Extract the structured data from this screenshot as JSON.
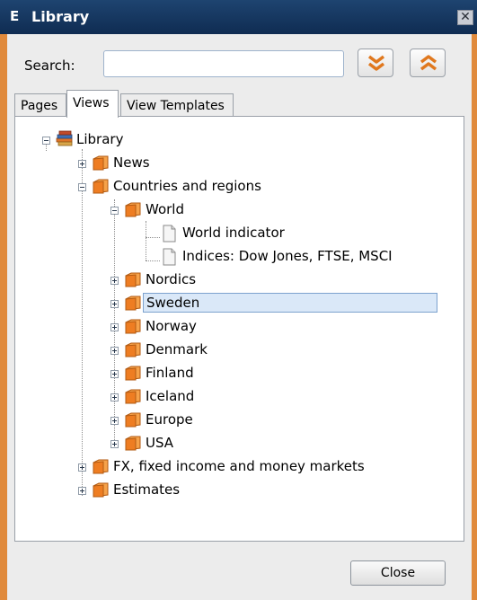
{
  "window": {
    "app_icon_letter": "E",
    "title": "Library"
  },
  "search": {
    "label": "Search:",
    "value": "",
    "placeholder": ""
  },
  "tabs": [
    {
      "label": "Pages",
      "active": false
    },
    {
      "label": "Views",
      "active": true
    },
    {
      "label": "View Templates",
      "active": false
    }
  ],
  "tree": {
    "root": "Library",
    "items": [
      {
        "label": "News",
        "type": "folder",
        "state": "collapsed"
      },
      {
        "label": "Countries and regions",
        "type": "folder",
        "state": "expanded"
      },
      {
        "label": "World",
        "type": "folder",
        "state": "expanded"
      },
      {
        "label": "World indicator",
        "type": "document"
      },
      {
        "label": "Indices: Dow Jones, FTSE, MSCI",
        "type": "document"
      },
      {
        "label": "Nordics",
        "type": "folder",
        "state": "collapsed"
      },
      {
        "label": "Sweden",
        "type": "folder",
        "state": "collapsed",
        "selected": true
      },
      {
        "label": "Norway",
        "type": "folder",
        "state": "collapsed"
      },
      {
        "label": "Denmark",
        "type": "folder",
        "state": "collapsed"
      },
      {
        "label": "Finland",
        "type": "folder",
        "state": "collapsed"
      },
      {
        "label": "Iceland",
        "type": "folder",
        "state": "collapsed"
      },
      {
        "label": "Europe",
        "type": "folder",
        "state": "collapsed"
      },
      {
        "label": "USA",
        "type": "folder",
        "state": "collapsed"
      },
      {
        "label": "FX, fixed income and money markets",
        "type": "folder",
        "state": "collapsed"
      },
      {
        "label": "Estimates",
        "type": "folder",
        "state": "collapsed"
      }
    ]
  },
  "buttons": {
    "close": "Close"
  },
  "colors": {
    "titlebar": "#0f2c52",
    "window_border": "#e08a3c",
    "arrow_icon": "#e0781e",
    "folder": "#f08a2a",
    "selection": "#dae8f8"
  }
}
